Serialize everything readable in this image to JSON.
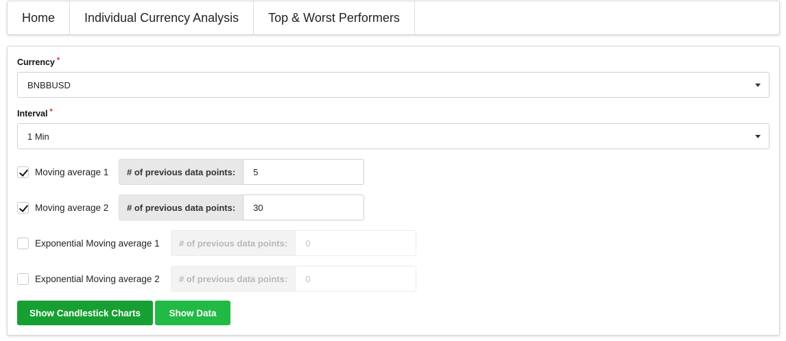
{
  "nav": {
    "items": [
      {
        "label": "Home"
      },
      {
        "label": "Individual Currency Analysis"
      },
      {
        "label": "Top & Worst Performers"
      }
    ]
  },
  "form": {
    "currency": {
      "label": "Currency",
      "required_mark": "*",
      "value": "BNBBUSD"
    },
    "interval": {
      "label": "Interval",
      "required_mark": "*",
      "value": "1 Min"
    },
    "moving_averages": [
      {
        "label": "Moving average 1",
        "checked": true,
        "points_label": "# of previous data points:",
        "points_value": "5"
      },
      {
        "label": "Moving average 2",
        "checked": true,
        "points_label": "# of previous data points:",
        "points_value": "30"
      },
      {
        "label": "Exponential Moving average 1",
        "checked": false,
        "points_label": "# of previous data points:",
        "points_value": "0"
      },
      {
        "label": "Exponential Moving average 2",
        "checked": false,
        "points_label": "# of previous data points:",
        "points_value": "0"
      }
    ],
    "buttons": {
      "show_candlestick": "Show Candlestick Charts",
      "show_data": "Show Data"
    }
  },
  "colors": {
    "primary_button": "#16a032",
    "secondary_button": "#21ba45"
  },
  "icons": {
    "dropdown": "chevron-down-icon",
    "check": "checkmark-icon"
  }
}
